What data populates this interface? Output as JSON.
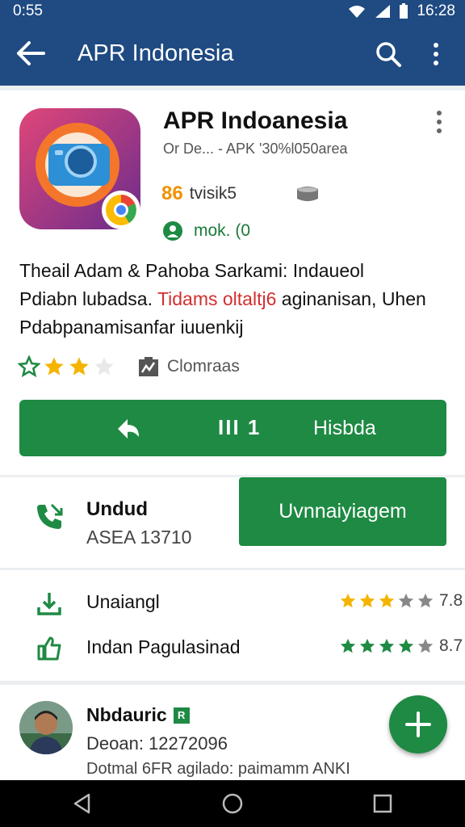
{
  "status": {
    "time": "0:55",
    "clock": "16:28"
  },
  "appbar": {
    "title": "APR Indonesia"
  },
  "app": {
    "title": "APR Indoanesia",
    "subtitle": "Or De... - APK '30%l050area",
    "meta_number": "86",
    "meta_label": "tvisik5",
    "meta2_label": "mok. (0",
    "description_line1": "Theail Adam & Pahoba Sarkami: Indaueol",
    "description_line2a": "Pdiabn lubadsa. ",
    "description_line2_red": "Tidams oltaltj6",
    "description_line2b": " aginanisan, Uhen",
    "description_line3": "Pdabpanamisanfar iuuenkij",
    "rating": 3,
    "category": "Clomraas"
  },
  "install_button": {
    "middle": "III 1",
    "label": "Hisbda"
  },
  "download_card": {
    "title": "Undud",
    "subtitle": "ASEA 13710",
    "button": "Uvnnaiyiagem"
  },
  "rows": [
    {
      "label": "Unaiangl",
      "stars": 3,
      "value": "7.8"
    },
    {
      "label": "Indan Pagulasinad",
      "stars": 4,
      "value": "8.7"
    }
  ],
  "review": {
    "name": "Nbdauric",
    "badge": "R",
    "date": "Deoan: 12272096",
    "text": "Dotmal 6FR agilado: paimamm ANKI"
  },
  "fab": {
    "label": "+"
  },
  "colors": {
    "primary": "#1f4a82",
    "accent": "#1e8a43",
    "star": "#f4b400",
    "text": "#212121"
  }
}
